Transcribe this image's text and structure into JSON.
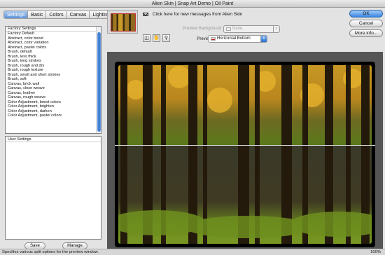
{
  "window": {
    "title": "Alien Skin | Snap Art Demo | Oil Paint"
  },
  "tabs": [
    {
      "label": "Settings",
      "active": true
    },
    {
      "label": "Basic",
      "active": false
    },
    {
      "label": "Colors",
      "active": false
    },
    {
      "label": "Canvas",
      "active": false
    },
    {
      "label": "Lighting",
      "active": false
    }
  ],
  "presets": {
    "header": "Factory Settings",
    "items": [
      "Factory Default",
      "Abstract, color boost",
      "Abstract, color variation",
      "Abstract, pastel colors",
      "Brush, default",
      "Brush, less thick",
      "Brush, long strokes",
      "Brush, rough and dry",
      "Brush, rough texture",
      "Brush, small and short strokes",
      "Brush, soft",
      "Canvas, brick wall",
      "Canvas, close weave",
      "Canvas, leather",
      "Canvas, rough weave",
      "Color Adjustment, boost colors",
      "Color Adjustment, brighten",
      "Color Adjustment, darken",
      "Color Adjustment, pastel colors"
    ]
  },
  "user_settings": {
    "header": "User Settings"
  },
  "left_buttons": {
    "save": "Save",
    "manage": "Manage"
  },
  "messages": {
    "text": "Click here for new messages from Alien Skin"
  },
  "preview_background": {
    "label": "Preview Background",
    "value": "None"
  },
  "preview_split": {
    "label": "Preview Split",
    "value": "Horizontal Bottom",
    "swatch": "#c0282a"
  },
  "buttons": {
    "ok": "OK",
    "cancel": "Cancel",
    "more_info": "More info..."
  },
  "status": {
    "text": "Specifies various split options for the preview window.",
    "zoom": "100%"
  },
  "colors": {
    "accent": "#3a86e3",
    "split_swatch": "#c0282a"
  },
  "icons": [
    "envelope-icon",
    "split-view-icon",
    "hand-icon",
    "zoom-icon"
  ]
}
